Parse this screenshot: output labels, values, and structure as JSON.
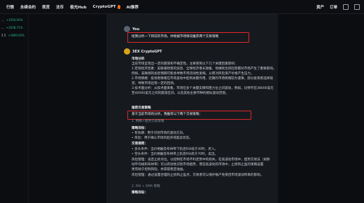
{
  "nav": {
    "items": [
      "行情",
      "永续合约",
      "现货",
      "法币",
      "极光Hub",
      "CryptoGPT",
      "AI推荐"
    ]
  },
  "header_right": {
    "assets": "资产",
    "orders": "订单"
  },
  "sidebar": {
    "tickers": [
      {
        "symbol": "...",
        "change": "+1050.00%"
      },
      {
        "symbol": "...",
        "change": "+2038.71%"
      },
      {
        "symbol": "2.5",
        "change": "+1860.65%"
      }
    ]
  },
  "chat": {
    "user_name": "You",
    "user_message": "给我分析一下目前的市场，并根据市场情况推荐两个交易策略",
    "bot_name": "3EX CryptoGPT",
    "lines": [
      "市场分析",
      "当前市场呈现出一定的震荡和不确定性。主要受到以下几个关键因素影响：",
      "1.宏观经济因素：美联储政策的加息、全球经济增长放缓、地缘政治风险等都对市场产生了重要影响。",
      "例如，美联储的加息预期可能会导致市场流动性紧缩，从而对风险资产价格产生压力。",
      "2.市场情绪：投资者情绪在市场波动中起到关键作用，近期的市场情绪较为谨慎，部分投资者选择观",
      "望，导致市场出现一定的回调。",
      "3.技术面分析：从技术面来看，市场在多个关键支撑和阻力位之间波动，例如，比特币在38000美元",
      "至40000美元之间的震荡区间，以及其他主要币种的相似波动范围。",
      "推荐交易策略",
      "基于当前市场的分析，我推荐以下两个交易策略：",
      "1. 网格+趋势交易策略",
      "策略目标：",
      "• 有效期：用于识别市场的波动方向。",
      "• 风险：用于确认市场的超买或超卖状态。",
      "交易规则：",
      "• 多头条件：当价格触及布林带下轨且RSI低于30时，买入。",
      "• 空头条件：当价格触及布林带上轨且RSI高于70时，卖出。",
      "风险管理：设定止损点位，以控制在市场不利走势中的损失。在高波动市场中，趋势交易法（如移",
      "动平均线和布林带）可以有效地识别市场趋势，而在低波动的市场中，止损和止盈的策略设置",
      "更有助于控制风险，并获取稳定收益。",
      "风险管理：通过设置合理的止损和止盈点，交易者可以保护账户免受因市场波动带来的影响。",
      "2. RSI + EMA 策略",
      "策略目标："
    ]
  },
  "colors": {
    "highlight": "#e0262a",
    "positive": "#2ebd85",
    "panel": "#161a1f",
    "background": "#0b0d10",
    "accent": "#ff6a1a"
  }
}
